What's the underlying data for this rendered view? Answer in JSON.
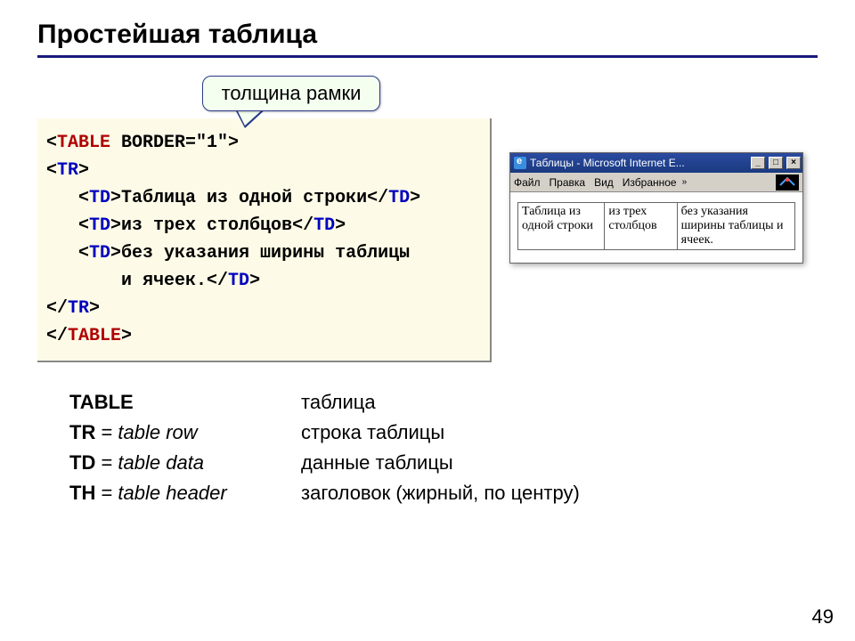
{
  "title": "Простейшая таблица",
  "callout": "толщина рамки",
  "code": {
    "l1a": "<",
    "l1b": "TABLE",
    "l1c": " BORDER=\"1\">",
    "l2a": "<",
    "l2b": "TR",
    "l2c": ">",
    "l3a": "   <",
    "l3b": "TD",
    "l3c": ">Таблица из одной строки</",
    "l3d": "TD",
    "l3e": ">",
    "l4a": "   <",
    "l4b": "TD",
    "l4c": ">из трех столбцов</",
    "l4d": "TD",
    "l4e": ">",
    "l5a": "   <",
    "l5b": "TD",
    "l5c": ">без указания ширины таблицы",
    "l6": "       и ячеек.</",
    "l6b": "TD",
    "l6c": ">",
    "l7a": "</",
    "l7b": "TR",
    "l7c": ">",
    "l8a": "</",
    "l8b": "TABLE",
    "l8c": ">"
  },
  "browser": {
    "title": "Таблицы - Microsoft Internet E...",
    "win_min": "_",
    "win_max": "□",
    "win_close": "×",
    "menu": {
      "file": "Файл",
      "edit": "Правка",
      "view": "Вид",
      "fav": "Избранное",
      "chev": "»"
    },
    "cells": [
      "Таблица из одной строки",
      "из трех столбцов",
      "без указания ширины таблицы и ячеек."
    ]
  },
  "defs": [
    {
      "tag": "TABLE",
      "eq": "",
      "en": "",
      "ru": "таблица"
    },
    {
      "tag": "TR",
      "eq": " = ",
      "en": "table row",
      "ru": "строка таблицы"
    },
    {
      "tag": "TD",
      "eq": " = ",
      "en": "table data",
      "ru": "данные таблицы"
    },
    {
      "tag": "TH",
      "eq": " = ",
      "en": "table header",
      "ru": "заголовок (жирный, по центру)"
    }
  ],
  "page": "49"
}
